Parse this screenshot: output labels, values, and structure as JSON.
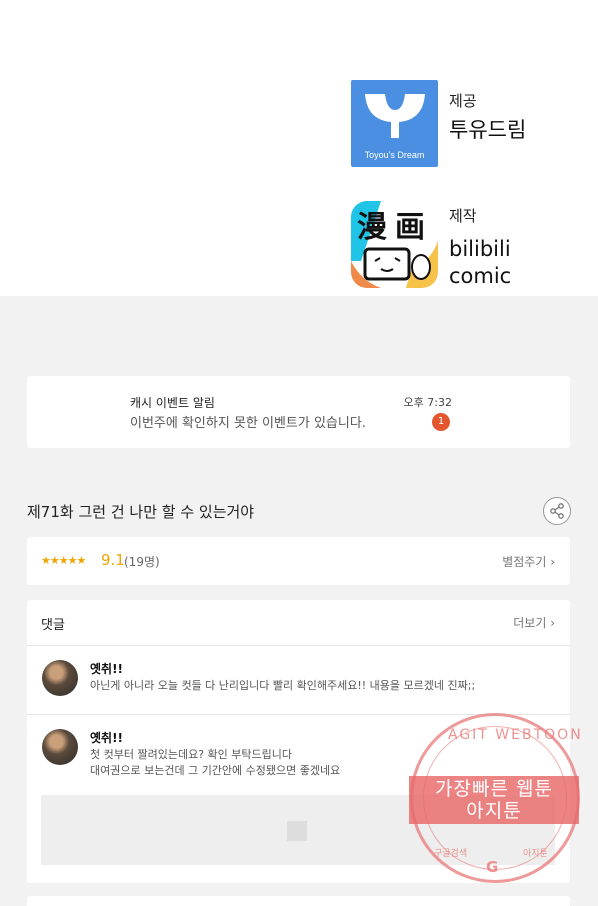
{
  "credits": {
    "provider_label": "제공",
    "provider_name": "투유드림",
    "provider_logo_text": "Toyou's Dream",
    "producer_label": "제작",
    "producer_name_line1": "bilibili",
    "producer_name_line2": "comic"
  },
  "notification": {
    "title": "캐시 이벤트 알림",
    "message": "이번주에 확인하지 못한 이벤트가 있습니다.",
    "time": "오후 7:32",
    "badge_count": "1"
  },
  "episode": {
    "title": "제71화 그런 건 나만 할 수 있는거야",
    "share_icon": "share-icon"
  },
  "rating": {
    "stars": "★★★★★",
    "score": "9.1",
    "votes": "(19명)",
    "rate_link": "별점주기 ›"
  },
  "comments": {
    "header": "댓글",
    "more": "더보기 ›",
    "items": [
      {
        "user": "옛취!!",
        "text_line1": "아닌게 아니라 오늘 컷들 다 난리입니다 빨리 확인해주세요!! 내용을 모르겠네 진짜;;"
      },
      {
        "user": "옛취!!",
        "text_line1": "첫 컷부터 짤려있는데요? 확인 부탁드립니다",
        "text_line2": "대여권으로 보는건데 그 기간안에 수정됐으면 좋겠네요"
      }
    ]
  },
  "watermark": {
    "arc_text": "AGIT WEBTOON",
    "band_line1": "가장빠른 웹툰",
    "band_line2": "아지툰",
    "bottom_left": "구글검색",
    "bottom_right": "아지툰"
  },
  "colors": {
    "accent_star": "#f0a500",
    "badge": "#e4572e",
    "provider_logo_bg": "#4a8fe2",
    "watermark": "#e86969"
  }
}
